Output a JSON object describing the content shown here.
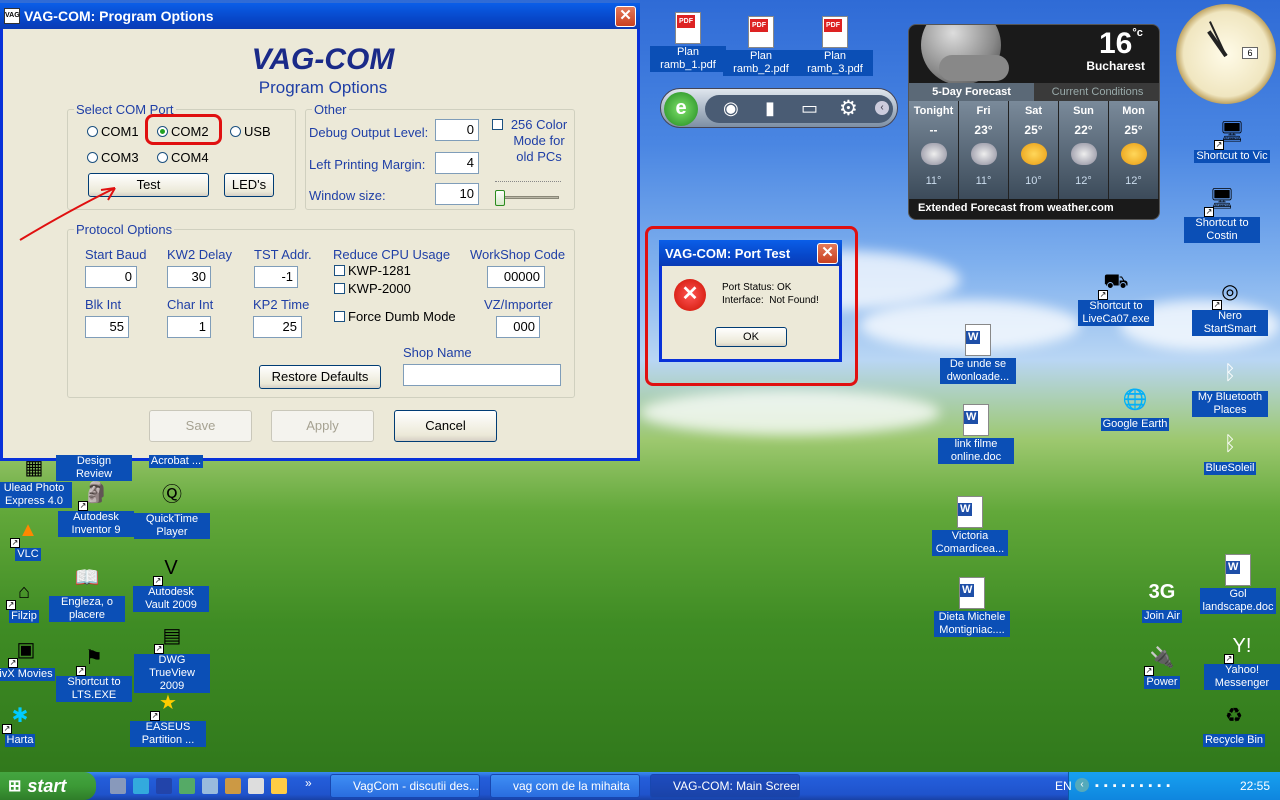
{
  "main_window": {
    "title": "VAG-COM: Program Options",
    "heading": "VAG-COM",
    "subheading": "Program Options",
    "com_port": {
      "legend": "Select COM Port",
      "options": [
        "COM1",
        "COM2",
        "USB",
        "COM3",
        "COM4"
      ],
      "selected": "COM2",
      "test_label": "Test",
      "leds_label": "LED's"
    },
    "other": {
      "legend": "Other",
      "debug_label": "Debug Output Level:",
      "debug_value": "0",
      "margin_label": "Left Printing Margin:",
      "margin_value": "4",
      "window_label": "Window size:",
      "window_value": "10",
      "color_mode_label": "256 Color Mode for old PCs"
    },
    "protocol": {
      "legend": "Protocol Options",
      "start_baud_label": "Start Baud",
      "start_baud": "0",
      "kw2_delay_label": "KW2 Delay",
      "kw2_delay": "30",
      "tst_addr_label": "TST Addr.",
      "tst_addr": "-1",
      "reduce_cpu_label": "Reduce CPU Usage",
      "kwp1281_label": "KWP-1281",
      "kwp2000_label": "KWP-2000",
      "workshop_label": "WorkShop Code",
      "workshop": "00000",
      "blk_int_label": "Blk Int",
      "blk_int": "55",
      "char_int_label": "Char Int",
      "char_int": "1",
      "kp2_time_label": "KP2 Time",
      "kp2_time": "25",
      "force_dumb_label": "Force Dumb Mode",
      "vz_label": "VZ/Importer",
      "vz": "000",
      "shop_name_label": "Shop Name",
      "shop_name": "",
      "restore_label": "Restore Defaults"
    },
    "buttons": {
      "save": "Save",
      "apply": "Apply",
      "cancel": "Cancel"
    }
  },
  "dialog": {
    "title": "VAG-COM: Port Test",
    "line1": "Port Status: OK",
    "line2": "Interface:  Not Found!",
    "ok": "OK"
  },
  "weather": {
    "temp": "16",
    "unit": "°c",
    "city": "Bucharest",
    "tab_forecast": "5-Day Forecast",
    "tab_current": "Current Conditions",
    "days": [
      {
        "name": "Tonight",
        "hi": "--",
        "lo": "11°",
        "icon": "rain-icon"
      },
      {
        "name": "Fri",
        "hi": "23°",
        "lo": "11°",
        "icon": "rain-icon"
      },
      {
        "name": "Sat",
        "hi": "25°",
        "lo": "10°",
        "icon": "sun-icon"
      },
      {
        "name": "Sun",
        "hi": "22°",
        "lo": "12°",
        "icon": "rain-icon"
      },
      {
        "name": "Mon",
        "hi": "25°",
        "lo": "12°",
        "icon": "sun-icon"
      }
    ],
    "footer": "Extended Forecast from weather.com"
  },
  "clock": {
    "date": "6"
  },
  "desktop_icons": {
    "plan1": "Plan ramb_1.pdf",
    "plan2": "Plan ramb_2.pdf",
    "plan3": "Plan ramb_3.pdf",
    "vic": "Shortcut to Vic",
    "costin": "Shortcut to Costin",
    "liveca": "Shortcut to LiveCa07.exe",
    "nero": "Nero StartSmart",
    "deunde": "De unde se dwonloade...",
    "bluetooth": "My Bluetooth Places",
    "googleearth": "Google Earth",
    "linkfilme": "link filme online.doc",
    "bluesoleil": "BlueSoleil",
    "victoria": "Victoria Comardicea...",
    "gol": "Gol landscape.doc",
    "joinair": "Join Air",
    "dieta": "Dieta  Michele Montigniac....",
    "yahoo": "Yahoo! Messenger",
    "power": "Power",
    "recycle": "Recycle Bin",
    "design": "Design Review",
    "acrobat": "Acrobat ...",
    "ulead": "Ulead Photo Express 4.0",
    "inventor": "Autodesk Inventor 9",
    "quicktime": "QuickTime Player",
    "vlc": "VLC",
    "vault": "Autodesk Vault 2009",
    "filzip": "Filzip",
    "engleza": "Engleza, o placere",
    "ivx": "ivX Movies",
    "dwg": "DWG TrueView 2009",
    "lts": "Shortcut to LTS.EXE",
    "harta": "Harta",
    "easeus": "EASEUS Partition ..."
  },
  "taskbar": {
    "start": "start",
    "tasks": [
      "VagCom - discutii des...",
      "vag com de la mihaita",
      "VAG-COM: Main Screen"
    ],
    "lang": "EN",
    "time": "22:55"
  }
}
